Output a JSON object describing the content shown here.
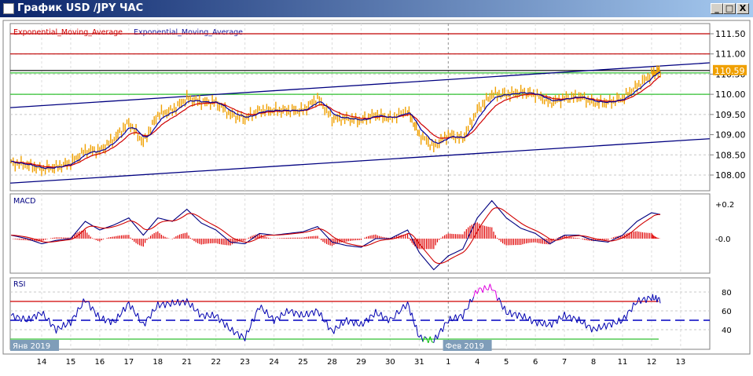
{
  "window": {
    "title": "График USD /JPY  ЧАС",
    "minimize": "_",
    "maximize": "□",
    "close": "X"
  },
  "legend": {
    "ema1": "Exponential_Moving_Average",
    "ema2": "Exponential_Moving_Average"
  },
  "colors": {
    "price": "#f0a000",
    "ema_fast": "#0000a0",
    "ema_slow": "#d00000",
    "channel": "#000080",
    "resistance": "#c00000",
    "support": "#30c030"
  },
  "chart_data": [
    {
      "type": "line",
      "title": "USD/JPY H1",
      "ylim": [
        107.8,
        111.7
      ],
      "yticks": [
        "111.50",
        "111.00",
        "110.50",
        "110.00",
        "109.50",
        "109.00",
        "108.50",
        "108.00"
      ],
      "ytick_values": [
        111.5,
        111.0,
        110.5,
        110.0,
        109.5,
        109.0,
        108.5,
        108.0
      ],
      "last_price_label": "110.59",
      "last_price": 110.59,
      "xticks": [
        "14",
        "15",
        "16",
        "17",
        "18",
        "21",
        "22",
        "23",
        "24",
        "25",
        "28",
        "29",
        "30",
        "31",
        "1",
        "4",
        "5",
        "6",
        "7",
        "8",
        "11",
        "12",
        "13"
      ],
      "month_labels": [
        {
          "label": "Янв 2019",
          "x": -1
        },
        {
          "label": "Фев 2019",
          "x": 13.9
        }
      ],
      "price": [
        [
          -1.05,
          108.3
        ],
        [
          -0.5,
          108.25
        ],
        [
          0,
          108.15
        ],
        [
          0.5,
          108.2
        ],
        [
          1,
          108.3
        ],
        [
          1.5,
          108.6
        ],
        [
          2,
          108.6
        ],
        [
          2.5,
          108.9
        ],
        [
          3,
          109.3
        ],
        [
          3.5,
          108.8
        ],
        [
          4,
          109.5
        ],
        [
          4.5,
          109.6
        ],
        [
          5,
          109.9
        ],
        [
          5.5,
          109.8
        ],
        [
          6,
          109.8
        ],
        [
          6.5,
          109.5
        ],
        [
          7,
          109.4
        ],
        [
          7.5,
          109.6
        ],
        [
          8,
          109.6
        ],
        [
          8.5,
          109.6
        ],
        [
          9,
          109.6
        ],
        [
          9.5,
          109.9
        ],
        [
          10,
          109.4
        ],
        [
          10.5,
          109.4
        ],
        [
          11,
          109.35
        ],
        [
          11.5,
          109.5
        ],
        [
          12,
          109.4
        ],
        [
          12.6,
          109.6
        ],
        [
          13,
          109.0
        ],
        [
          13.5,
          108.7
        ],
        [
          14,
          109.0
        ],
        [
          14.5,
          108.9
        ],
        [
          15,
          109.6
        ],
        [
          15.5,
          110.0
        ],
        [
          16,
          110.0
        ],
        [
          16.5,
          110.05
        ],
        [
          17,
          110.0
        ],
        [
          17.5,
          109.8
        ],
        [
          18,
          109.9
        ],
        [
          18.5,
          109.95
        ],
        [
          19,
          109.8
        ],
        [
          19.5,
          109.8
        ],
        [
          20,
          109.9
        ],
        [
          20.5,
          110.2
        ],
        [
          21,
          110.5
        ],
        [
          21.3,
          110.59
        ]
      ],
      "channels": [
        {
          "from": [
            -1.08,
            107.8
          ],
          "to": [
            23,
            108.9
          ]
        },
        {
          "from": [
            -1.08,
            109.67
          ],
          "to": [
            23,
            110.78
          ]
        }
      ],
      "horizontal_levels": [
        {
          "value": 111.5,
          "color": "resistance"
        },
        {
          "value": 111.0,
          "color": "resistance"
        },
        {
          "value": 110.59,
          "color": "black"
        },
        {
          "value": 110.53,
          "color": "support"
        },
        {
          "value": 110.0,
          "color": "support"
        }
      ]
    },
    {
      "type": "line",
      "title": "MACD",
      "ylim": [
        -0.1,
        0.25
      ],
      "yticks": [
        "+0.2",
        "-0.0"
      ],
      "ytick_values": [
        0.2,
        0.0
      ],
      "macd": [
        [
          -1.05,
          0.02
        ],
        [
          -0.5,
          0.0
        ],
        [
          0,
          -0.03
        ],
        [
          0.5,
          -0.01
        ],
        [
          1,
          0.0
        ],
        [
          1.5,
          0.1
        ],
        [
          2,
          0.05
        ],
        [
          2.5,
          0.08
        ],
        [
          3,
          0.12
        ],
        [
          3.5,
          0.02
        ],
        [
          4,
          0.12
        ],
        [
          4.5,
          0.1
        ],
        [
          5,
          0.17
        ],
        [
          5.5,
          0.09
        ],
        [
          6,
          0.05
        ],
        [
          6.5,
          -0.02
        ],
        [
          7,
          -0.03
        ],
        [
          7.5,
          0.03
        ],
        [
          8,
          0.02
        ],
        [
          8.5,
          0.03
        ],
        [
          9,
          0.04
        ],
        [
          9.5,
          0.07
        ],
        [
          10,
          -0.02
        ],
        [
          10.5,
          -0.04
        ],
        [
          11,
          -0.05
        ],
        [
          11.5,
          0.0
        ],
        [
          12,
          0.0
        ],
        [
          12.6,
          0.05
        ],
        [
          13,
          -0.08
        ],
        [
          13.5,
          -0.18
        ],
        [
          14,
          -0.1
        ],
        [
          14.5,
          -0.06
        ],
        [
          15,
          0.12
        ],
        [
          15.5,
          0.22
        ],
        [
          16,
          0.12
        ],
        [
          16.5,
          0.06
        ],
        [
          17,
          0.03
        ],
        [
          17.5,
          -0.03
        ],
        [
          18,
          0.02
        ],
        [
          18.5,
          0.02
        ],
        [
          19,
          -0.01
        ],
        [
          19.5,
          -0.02
        ],
        [
          20,
          0.02
        ],
        [
          20.5,
          0.1
        ],
        [
          21,
          0.15
        ],
        [
          21.3,
          0.14
        ]
      ],
      "signal_smoothing": 0.35
    },
    {
      "type": "line",
      "title": "RSI",
      "ylim": [
        20,
        92
      ],
      "yticks": [
        "80",
        "60",
        "40"
      ],
      "ytick_values": [
        80,
        60,
        40
      ],
      "levels": {
        "overbought": 70,
        "mid": 50,
        "oversold": 30
      },
      "rsi": [
        [
          -1.05,
          55
        ],
        [
          -0.5,
          50
        ],
        [
          0,
          58
        ],
        [
          0.5,
          40
        ],
        [
          1,
          48
        ],
        [
          1.5,
          72
        ],
        [
          2,
          52
        ],
        [
          2.5,
          48
        ],
        [
          3,
          68
        ],
        [
          3.5,
          45
        ],
        [
          4,
          66
        ],
        [
          4.5,
          68
        ],
        [
          5,
          70
        ],
        [
          5.5,
          55
        ],
        [
          6,
          55
        ],
        [
          6.5,
          40
        ],
        [
          7,
          31
        ],
        [
          7.5,
          65
        ],
        [
          8,
          50
        ],
        [
          8.5,
          60
        ],
        [
          9,
          55
        ],
        [
          9.5,
          60
        ],
        [
          10,
          38
        ],
        [
          10.5,
          50
        ],
        [
          11,
          45
        ],
        [
          11.5,
          58
        ],
        [
          12,
          50
        ],
        [
          12.6,
          68
        ],
        [
          13,
          32
        ],
        [
          13.5,
          28
        ],
        [
          14,
          50
        ],
        [
          14.5,
          55
        ],
        [
          15,
          82
        ],
        [
          15.5,
          85
        ],
        [
          16,
          58
        ],
        [
          16.5,
          55
        ],
        [
          17,
          48
        ],
        [
          17.5,
          45
        ],
        [
          18,
          55
        ],
        [
          18.5,
          50
        ],
        [
          19,
          40
        ],
        [
          19.5,
          45
        ],
        [
          20,
          50
        ],
        [
          20.5,
          70
        ],
        [
          21,
          74
        ],
        [
          21.3,
          72
        ]
      ]
    }
  ]
}
